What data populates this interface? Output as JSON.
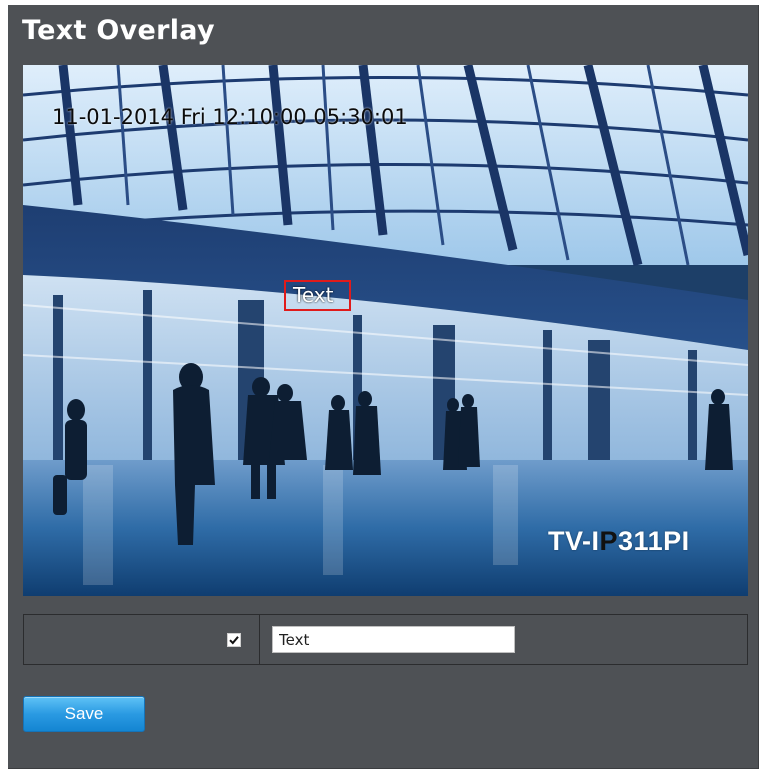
{
  "panel": {
    "title": "Text Overlay"
  },
  "preview": {
    "osd_datetime": "11-01-2014 Fri 12:10:00 05:30:01",
    "osd_text": "Text",
    "model_prefix": "TV-I",
    "model_highlight": "P",
    "model_suffix": "311PI",
    "colors": {
      "osd_box": "#e01b1b",
      "model_highlight": "#111111"
    }
  },
  "overlay_row": {
    "enabled": true,
    "text_value": "Text"
  },
  "actions": {
    "save_label": "Save"
  },
  "colors": {
    "panel_bg": "#4e5155",
    "save_button": "#2a9ae2"
  },
  "icons": {
    "checkbox": "checkmark-icon"
  }
}
